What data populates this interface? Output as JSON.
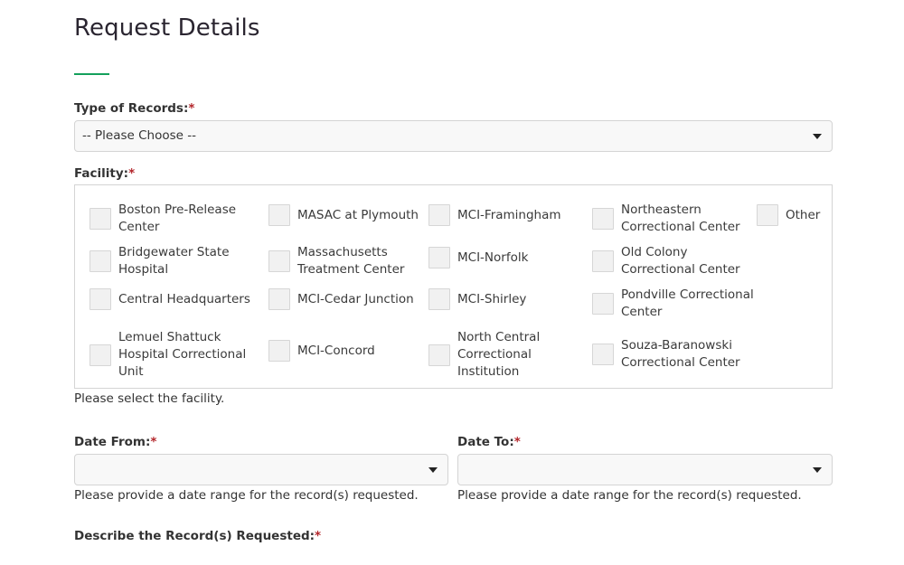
{
  "page": {
    "title": "Request Details"
  },
  "type_of_records": {
    "label": "Type of Records:",
    "required_mark": "*",
    "value": "--  Please Choose --"
  },
  "facility": {
    "label": "Facility:",
    "required_mark": "*",
    "help": "Please select the facility.",
    "options": [
      {
        "label": "Boston Pre-Release Center",
        "line1": "Boston Pre-Release",
        "line2": "Center",
        "line3": "",
        "checked": false
      },
      {
        "label": "Bridgewater State Hospital",
        "line1": "Bridgewater State",
        "line2": "Hospital",
        "line3": "",
        "checked": false
      },
      {
        "label": "Central Headquarters",
        "line1": "Central Headquarters",
        "line2": "",
        "line3": "",
        "checked": false
      },
      {
        "label": "Lemuel Shattuck Hospital Correctional Unit",
        "line1": "Lemuel Shattuck",
        "line2": "Hospital Correctional",
        "line3": "Unit",
        "checked": false
      },
      {
        "label": "MASAC at Plymouth",
        "line1": "MASAC at Plymouth",
        "line2": "",
        "line3": "",
        "checked": false
      },
      {
        "label": "Massachusetts Treatment Center",
        "line1": "Massachusetts",
        "line2": "Treatment Center",
        "line3": "",
        "checked": false
      },
      {
        "label": "MCI-Cedar Junction",
        "line1": "MCI-Cedar Junction",
        "line2": "",
        "line3": "",
        "checked": false
      },
      {
        "label": "MCI-Concord",
        "line1": "MCI-Concord",
        "line2": "",
        "line3": "",
        "checked": false
      },
      {
        "label": "MCI-Framingham",
        "line1": "MCI-Framingham",
        "line2": "",
        "line3": "",
        "checked": false
      },
      {
        "label": "MCI-Norfolk",
        "line1": "MCI-Norfolk",
        "line2": "",
        "line3": "",
        "checked": false
      },
      {
        "label": "MCI-Shirley",
        "line1": "MCI-Shirley",
        "line2": "",
        "line3": "",
        "checked": false
      },
      {
        "label": "North Central Correctional Institution",
        "line1": "North Central",
        "line2": "Correctional",
        "line3": "Institution",
        "checked": false
      },
      {
        "label": "Northeastern Correctional Center",
        "line1": "Northeastern",
        "line2": "Correctional Center",
        "line3": "",
        "checked": false
      },
      {
        "label": "Old Colony Correctional Center",
        "line1": "Old Colony",
        "line2": "Correctional Center",
        "line3": "",
        "checked": false
      },
      {
        "label": "Pondville Correctional Center",
        "line1": "Pondville Correctional",
        "line2": "Center",
        "line3": "",
        "checked": false
      },
      {
        "label": "Souza-Baranowski Correctional Center",
        "line1": "Souza-Baranowski",
        "line2": "Correctional Center",
        "line3": "",
        "checked": false
      },
      {
        "label": "Other",
        "line1": "Other",
        "line2": "",
        "line3": "",
        "checked": false
      }
    ]
  },
  "date_from": {
    "label": "Date From:",
    "required_mark": "*",
    "value": "",
    "help": "Please provide a date range for the record(s) requested."
  },
  "date_to": {
    "label": "Date To:",
    "required_mark": "*",
    "value": "",
    "help": "Please provide a date range for the record(s) requested."
  },
  "describe": {
    "label": "Describe the Record(s) Requested:",
    "required_mark": "*"
  },
  "colors": {
    "accent": "#14a05c",
    "required": "#b3262b"
  }
}
